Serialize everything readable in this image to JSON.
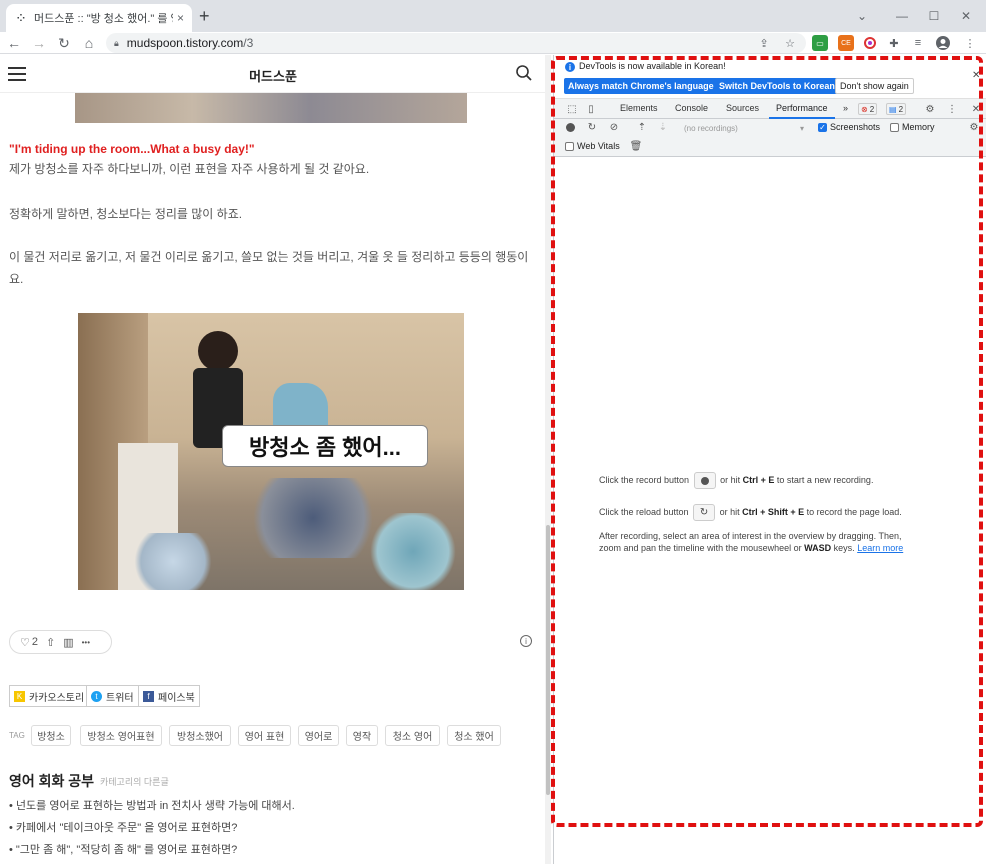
{
  "browser": {
    "tab_title": "머드스푼 :: \"방 청소 했어.\" 를 영",
    "tab_close": "×",
    "new_tab": "+",
    "url_host": "mudspoon.tistory.com",
    "url_path": "/3",
    "window_controls": [
      "⌄",
      "—",
      "☐",
      "✕"
    ]
  },
  "blog": {
    "title": "머드스푼",
    "quote_en": "\"I'm tiding up the room...What a busy day!\"",
    "paragraphs": [
      "제가 방청소를 자주 하다보니까, 이런 표현을 자주 사용하게 될 것 같아요.",
      "정확하게 말하면, 청소보다는 정리를 많이 하죠.",
      "이 물건 저리로 옮기고, 저 물건 이리로 옮기고, 쓸모 없는 것들 버리고, 겨울 옷 들 정리하고 등등의 행동이요."
    ],
    "gif_caption": "방청소 좀 했어...",
    "like_count": "2",
    "reaction_more": "•••",
    "share": [
      {
        "label": "카카오스토리",
        "color": "#f7c600",
        "glyph": "K"
      },
      {
        "label": "트위터",
        "color": "#1da1f2",
        "glyph": "t"
      },
      {
        "label": "페이스북",
        "color": "#3b5998",
        "glyph": "f"
      }
    ],
    "tags_label": "TAG",
    "tags": [
      "방청소",
      "방청소 영어표현",
      "방청소했어",
      "영어 표현",
      "영어로",
      "영작",
      "청소 영어",
      "청소 했어"
    ],
    "category_title": "영어 회화 공부",
    "category_sub": "카테고리의 다른글",
    "category_items": [
      "• 넌도를 영어로 표현하는 방법과 in 전치사 생략 가능에 대해서.",
      "• 카페에서 \"테이크아웃 주문\" 을 영어로 표현하면?",
      "• \"그만 좀 해\", \"적당히 좀 해\" 를 영어로 표현하면?"
    ]
  },
  "devtools": {
    "info_message": "DevTools is now available in Korean!",
    "btn_match": "Always match Chrome's language",
    "btn_switch": "Switch DevTools to Korean",
    "btn_dont": "Don't show again",
    "tabs": [
      "Elements",
      "Console",
      "Sources",
      "Performance"
    ],
    "tabs_more": "»",
    "error_count": "2",
    "message_count": "2",
    "recordings_placeholder": "(no recordings)",
    "screenshots_label": "Screenshots",
    "memory_label": "Memory",
    "web_vitals_label": "Web Vitals",
    "landing": {
      "rec_pre": "Click the record button",
      "rec_mid": "or hit",
      "rec_key": "Ctrl + E",
      "rec_post": "to start a new recording.",
      "reload_pre": "Click the reload button",
      "reload_mid": "or hit",
      "reload_key": "Ctrl + Shift + E",
      "reload_post": "to record the page load.",
      "after_line1": "After recording, select an area of interest in the overview by dragging. Then,",
      "after_line2_pre": "zoom and pan the timeline with the mousewheel or",
      "after_line2_key": "WASD",
      "after_line2_mid": "keys.",
      "learn_more": "Learn more"
    }
  },
  "colors": {
    "accent_blue": "#1a73e8",
    "quote_red": "#e02020",
    "annotation_red": "#e01010"
  }
}
